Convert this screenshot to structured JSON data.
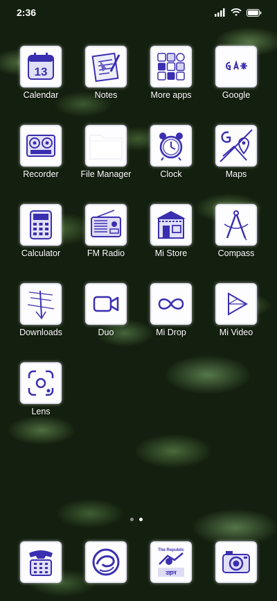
{
  "status_bar": {
    "time": "2:36",
    "icons": [
      "signal-icon",
      "wifi-icon",
      "battery-icon"
    ]
  },
  "apps": [
    {
      "label": "Calendar",
      "icon": "calendar-icon",
      "badge_text": "13"
    },
    {
      "label": "Notes",
      "icon": "notes-icon"
    },
    {
      "label": "More apps",
      "icon": "more-apps-icon"
    },
    {
      "label": "Google",
      "icon": "google-icon"
    },
    {
      "label": "Recorder",
      "icon": "recorder-icon"
    },
    {
      "label": "File Manager",
      "icon": "folder-icon"
    },
    {
      "label": "Clock",
      "icon": "alarm-clock-icon"
    },
    {
      "label": "Maps",
      "icon": "maps-icon"
    },
    {
      "label": "Calculator",
      "icon": "calculator-icon"
    },
    {
      "label": "FM Radio",
      "icon": "radio-icon"
    },
    {
      "label": "Mi Store",
      "icon": "store-icon"
    },
    {
      "label": "Compass",
      "icon": "compass-icon"
    },
    {
      "label": "Downloads",
      "icon": "downloads-icon"
    },
    {
      "label": "Duo",
      "icon": "video-camera-icon"
    },
    {
      "label": "Mi Drop",
      "icon": "infinity-icon"
    },
    {
      "label": "Mi Video",
      "icon": "play-icon"
    },
    {
      "label": "Lens",
      "icon": "lens-icon"
    }
  ],
  "page_indicator": {
    "count": 2,
    "active": 1
  },
  "dock": [
    {
      "icon": "phone-icon"
    },
    {
      "icon": "messages-icon"
    },
    {
      "icon": "stamp-icon",
      "stamp_text_top": "The Republic",
      "stamp_text_bottom": "उड़ान"
    },
    {
      "icon": "camera-icon"
    }
  ],
  "colors": {
    "icon_ink": "#3a2fb0",
    "icon_bg": "#fdfdff",
    "label": "#ffffff"
  }
}
